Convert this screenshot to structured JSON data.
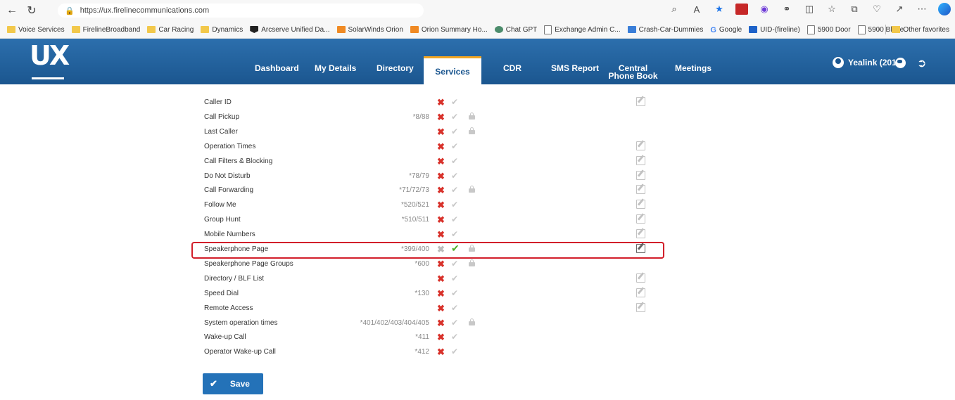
{
  "browser": {
    "url": "https://ux.firelinecommunications.com",
    "favorites": [
      {
        "label": "Voice Services",
        "icon": "folder-icon",
        "cls": "folder"
      },
      {
        "label": "FirelineBroadband",
        "icon": "folder-icon",
        "cls": "folder"
      },
      {
        "label": "Car Racing",
        "icon": "folder-icon",
        "cls": "folder"
      },
      {
        "label": "Dynamics",
        "icon": "folder-icon",
        "cls": "folder"
      },
      {
        "label": "Arcserve Unified Da...",
        "icon": "shield-icon",
        "cls": "fi-dark"
      },
      {
        "label": "SolarWinds Orion",
        "icon": "solarwinds-icon",
        "cls": "fi-orange"
      },
      {
        "label": "Orion Summary Ho...",
        "icon": "solarwinds-icon",
        "cls": "fi-orange"
      },
      {
        "label": "Chat GPT",
        "icon": "chatgpt-icon",
        "cls": "fi-green"
      },
      {
        "label": "Exchange Admin C...",
        "icon": "page-icon",
        "cls": "page"
      },
      {
        "label": "Crash-Car-Dummies",
        "icon": "site-icon",
        "cls": "fi-lblue"
      },
      {
        "label": "Google",
        "icon": "google-icon",
        "cls": "fi-g",
        "glyph": "G"
      },
      {
        "label": "UID-(fireline)",
        "icon": "uid-icon",
        "cls": "fi-blue"
      },
      {
        "label": "5900 Door",
        "icon": "page-icon",
        "cls": "page"
      },
      {
        "label": "5900 Blade",
        "icon": "page-icon",
        "cls": "page"
      }
    ],
    "other_favorites": "Other favorites"
  },
  "app": {
    "logo": "UX",
    "nav": [
      {
        "label": "Dashboard",
        "active": false
      },
      {
        "label": "My Details",
        "active": false
      },
      {
        "label": "Directory",
        "active": false
      },
      {
        "label": "Services",
        "active": true
      },
      {
        "label": "CDR",
        "active": false
      },
      {
        "label": "SMS Report",
        "active": false
      },
      {
        "label": "Central Phone Book",
        "active": false
      },
      {
        "label": "Meetings",
        "active": false
      }
    ],
    "user": "Yealink (2016)"
  },
  "services": [
    {
      "name": "Caller ID",
      "code": "",
      "enabled": false,
      "locked": false,
      "editable": true
    },
    {
      "name": "Call Pickup",
      "code": "*8/88",
      "enabled": false,
      "locked": true,
      "editable": false
    },
    {
      "name": "Last Caller",
      "code": "",
      "enabled": false,
      "locked": true,
      "editable": false
    },
    {
      "name": "Operation Times",
      "code": "",
      "enabled": false,
      "locked": false,
      "editable": true
    },
    {
      "name": "Call Filters & Blocking",
      "code": "",
      "enabled": false,
      "locked": false,
      "editable": true
    },
    {
      "name": "Do Not Disturb",
      "code": "*78/79",
      "enabled": false,
      "locked": false,
      "editable": true
    },
    {
      "name": "Call Forwarding",
      "code": "*71/72/73",
      "enabled": false,
      "locked": true,
      "editable": true
    },
    {
      "name": "Follow Me",
      "code": "*520/521",
      "enabled": false,
      "locked": false,
      "editable": true
    },
    {
      "name": "Group Hunt",
      "code": "*510/511",
      "enabled": false,
      "locked": false,
      "editable": true
    },
    {
      "name": "Mobile Numbers",
      "code": "",
      "enabled": false,
      "locked": false,
      "editable": true
    },
    {
      "name": "Speakerphone Page",
      "code": "*399/400",
      "enabled": true,
      "locked": true,
      "editable": true,
      "highlighted": true
    },
    {
      "name": "Speakerphone Page Groups",
      "code": "*600",
      "enabled": false,
      "locked": true,
      "editable": false
    },
    {
      "name": "Directory / BLF List",
      "code": "",
      "enabled": false,
      "locked": false,
      "editable": true
    },
    {
      "name": "Speed Dial",
      "code": "*130",
      "enabled": false,
      "locked": false,
      "editable": true
    },
    {
      "name": "Remote Access",
      "code": "",
      "enabled": false,
      "locked": false,
      "editable": true
    },
    {
      "name": "System operation times",
      "code": "*401/402/403/404/405",
      "enabled": false,
      "locked": true,
      "editable": false
    },
    {
      "name": "Wake-up Call",
      "code": "*411",
      "enabled": false,
      "locked": false,
      "editable": false
    },
    {
      "name": "Operator Wake-up Call",
      "code": "*412",
      "enabled": false,
      "locked": false,
      "editable": false
    }
  ],
  "save_label": "Save",
  "colors": {
    "header": "#1b568f",
    "accent": "#f2a623",
    "disable": "#d8312a",
    "enable": "#4caf28",
    "highlight": "#d21f2a"
  }
}
